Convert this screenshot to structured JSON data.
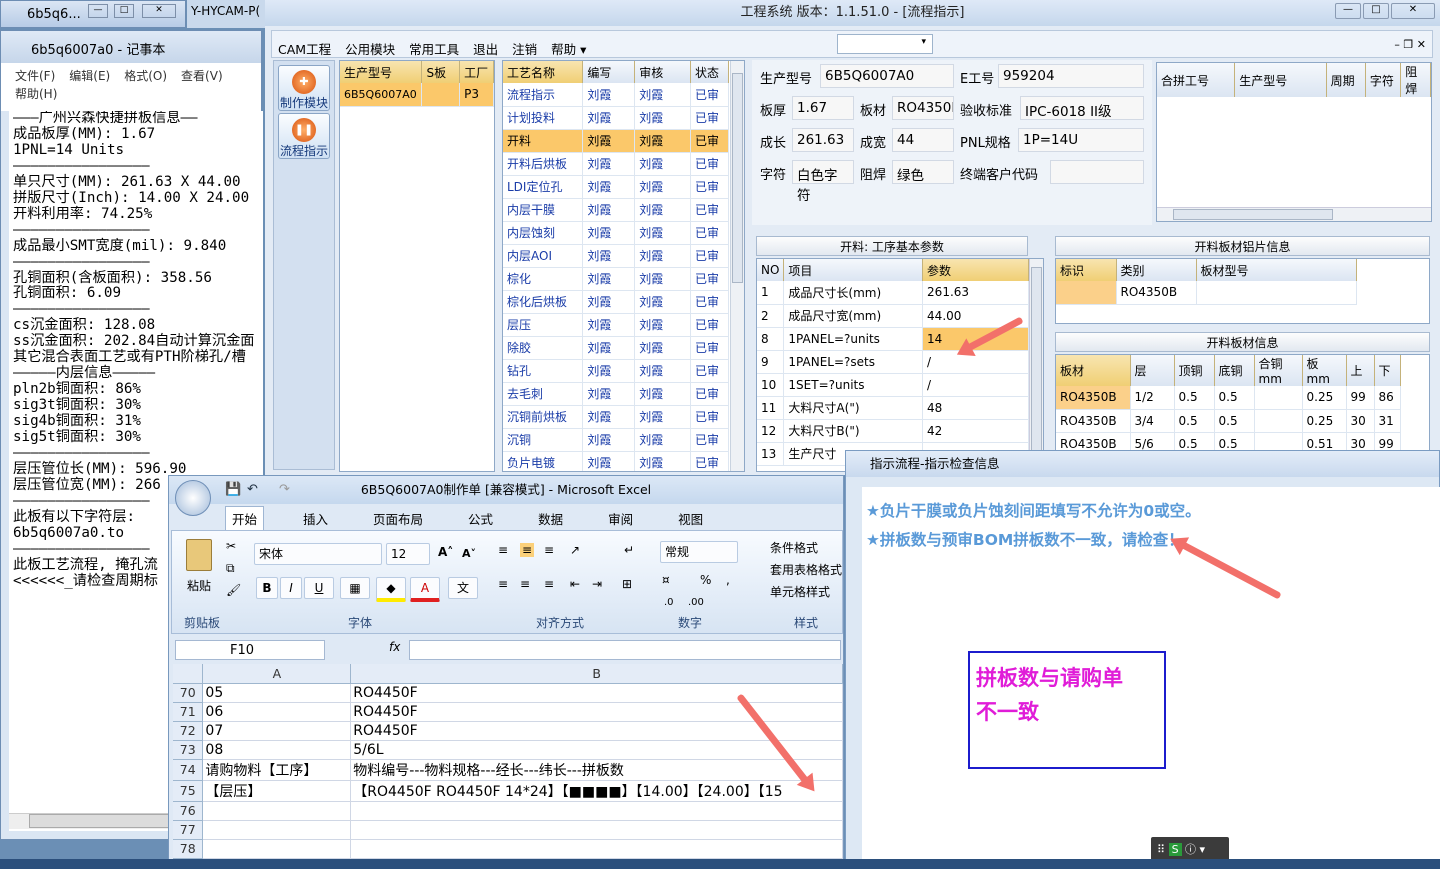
{
  "taskbar_items": {
    "tab1": "6b5q6...",
    "tab2": "Y-HYCAM-P("
  },
  "notepad": {
    "title": "6b5q6007a0 - 记事本",
    "menu": [
      "文件(F)",
      "编辑(E)",
      "格式(O)",
      "查看(V)",
      "帮助(H)"
    ],
    "text": "———广州兴森快捷拼板信息——\n成品板厚(MM): 1.67\n1PNL=14 Units\n————————————————\n单只尺寸(MM): 261.63 X 44.00\n拼版尺寸(Inch): 14.00 X 24.00\n开料利用率: 74.25%\n————————————————\n成品最小SMT宽度(mil): 9.840\n————————————————\n孔铜面积(含板面积): 358.56\n孔铜面积: 6.09\n————————————————\ncs沉金面积: 128.08\nss沉金面积: 202.84自动计算沉金面\n其它混合表面工艺或有PTH阶梯孔/槽\n—————内层信息—————\npln2b铜面积: 86%\nsig3t铜面积: 30%\nsig4b铜面积: 31%\nsig5t铜面积: 30%\n————————————————\n层压管位长(MM): 596.90\n层压管位宽(MM): 266\n————————————————\n此板有以下字符层:\n6b5q6007a0.to\n————————————————\n此板工艺流程, 掩孔流\n<<<<<<_请检查周期标"
  },
  "main": {
    "title": "工程系统  版本：1.1.51.0 - [流程指示]",
    "menu": [
      "CAM工程",
      "公用模块",
      "常用工具",
      "退出",
      "注销",
      "帮助"
    ],
    "nav": [
      "制作模块",
      "流程指示"
    ],
    "products": {
      "headers": [
        "生产型号",
        "S板",
        "工厂"
      ],
      "rows": [
        [
          "6B5Q6007A0",
          "",
          "P3"
        ]
      ]
    },
    "process": {
      "headers": [
        "工艺名称",
        "编写",
        "审核",
        "状态"
      ],
      "rows": [
        [
          "流程指示",
          "刘霞",
          "刘霞",
          "已审"
        ],
        [
          "计划投料",
          "刘霞",
          "刘霞",
          "已审"
        ],
        [
          "开料",
          "刘霞",
          "刘霞",
          "已审"
        ],
        [
          "开料后烘板",
          "刘霞",
          "刘霞",
          "已审"
        ],
        [
          "LDI定位孔",
          "刘霞",
          "刘霞",
          "已审"
        ],
        [
          "内层干膜",
          "刘霞",
          "刘霞",
          "已审"
        ],
        [
          "内层蚀刻",
          "刘霞",
          "刘霞",
          "已审"
        ],
        [
          "内层AOI",
          "刘霞",
          "刘霞",
          "已审"
        ],
        [
          "棕化",
          "刘霞",
          "刘霞",
          "已审"
        ],
        [
          "棕化后烘板",
          "刘霞",
          "刘霞",
          "已审"
        ],
        [
          "层压",
          "刘霞",
          "刘霞",
          "已审"
        ],
        [
          "除胶",
          "刘霞",
          "刘霞",
          "已审"
        ],
        [
          "钻孔",
          "刘霞",
          "刘霞",
          "已审"
        ],
        [
          "去毛刺",
          "刘霞",
          "刘霞",
          "已审"
        ],
        [
          "沉铜前烘板",
          "刘霞",
          "刘霞",
          "已审"
        ],
        [
          "沉铜",
          "刘霞",
          "刘霞",
          "已审"
        ],
        [
          "负片电镀",
          "刘霞",
          "刘霞",
          "已审"
        ]
      ]
    },
    "info": {
      "model_label": "生产型号",
      "model": "6B5Q6007A0",
      "eng_label": "E工号",
      "eng": "959204",
      "thick_label": "板厚",
      "thick": "1.67",
      "mat_label": "板材",
      "mat": "RO4350B",
      "std_label": "验收标准",
      "std": "IPC-6018 II级",
      "len_label": "成长",
      "len": "261.63",
      "wid_label": "成宽",
      "wid": "44",
      "pnl_label": "PNL规格",
      "pnl": "1P=14U",
      "char_label": "字符",
      "char": "白色字符",
      "mask_label": "阻焊",
      "mask": "绿色",
      "cust_label": "终端客户代码",
      "cust": ""
    },
    "merge": {
      "headers": [
        "合拼工号",
        "生产型号",
        "周期",
        "字符",
        "阻焊"
      ]
    },
    "params": {
      "header": "开料: 工序基本参数",
      "cols": [
        "NO",
        "项目",
        "参数"
      ],
      "rows": [
        [
          "1",
          "成品尺寸长(mm)",
          "261.63"
        ],
        [
          "2",
          "成品尺寸宽(mm)",
          "44.00"
        ],
        [
          "8",
          "1PANEL=?units",
          "14"
        ],
        [
          "9",
          "1PANEL=?sets",
          "/"
        ],
        [
          "10",
          "1SET=?units",
          "/"
        ],
        [
          "11",
          "大料尺寸A(\")",
          "48"
        ],
        [
          "12",
          "大料尺寸B(\")",
          "42"
        ],
        [
          "13",
          "生产尺寸",
          ""
        ]
      ]
    },
    "sheetmat": {
      "header": "开料板材铝片信息",
      "cols": [
        "标识",
        "类别",
        "板材型号"
      ],
      "rows": [
        [
          "",
          "RO4350B",
          ""
        ]
      ]
    },
    "matinfo": {
      "header": "开料板材信息",
      "cols": [
        "板材",
        "层",
        "顶铜",
        "底铜",
        "合铜mm",
        "板mm",
        "上",
        "下"
      ],
      "rows": [
        [
          "RO4350B",
          "1/2",
          "0.5",
          "0.5",
          "",
          "0.25",
          "99",
          "86"
        ],
        [
          "RO4350B",
          "3/4",
          "0.5",
          "0.5",
          "",
          "0.25",
          "30",
          "31"
        ],
        [
          "RO4350B",
          "5/6",
          "0.5",
          "0.5",
          "",
          "0.51",
          "30",
          "99"
        ]
      ]
    }
  },
  "excel": {
    "title": "6B5Q6007A0制作单  [兼容模式] - Microsoft Excel",
    "tabs": [
      "开始",
      "插入",
      "页面布局",
      "公式",
      "数据",
      "审阅",
      "视图"
    ],
    "ribbon": {
      "paste": "粘贴",
      "clipboard": "剪贴板",
      "font_group": "字体",
      "font": "宋体",
      "size": "12",
      "align_group": "对齐方式",
      "num_group": "数字",
      "num_fmt": "常规",
      "style_group": "样式",
      "cond": "条件格式",
      "tablefmt": "套用表格格式",
      "cellstyle": "单元格样式",
      "bold": "B",
      "italic": "I",
      "underline": "U",
      "pct": "%"
    },
    "namebox": "F10",
    "fx": "fx",
    "cols": [
      "A",
      "B"
    ],
    "rows": [
      [
        "70",
        "05",
        "RO4450F"
      ],
      [
        "71",
        "06",
        "RO4450F"
      ],
      [
        "72",
        "07",
        "RO4450F"
      ],
      [
        "73",
        "08",
        "5/6L"
      ],
      [
        "74",
        "请购物料【工序】",
        "物料编号---物料规格---经长---纬长---拼板数"
      ],
      [
        "75",
        "【层压】",
        "【RO4450F RO4450F  14*24】【■■■■】【14.00】【24.00】【15"
      ],
      [
        "76",
        "",
        ""
      ],
      [
        "77",
        "",
        ""
      ],
      [
        "78",
        "",
        ""
      ]
    ]
  },
  "dialog": {
    "title": "指示流程-指示检查信息",
    "msg1": "★负片干膜或负片蚀刻间距填写不允许为0或空。",
    "msg2": "★拼板数与预审BOM拼板数不一致，请检查！",
    "note_line1": "拼板数与请购单",
    "note_line2": "不一致"
  },
  "colors": {
    "accent": "#f0cf74",
    "arrow": "#f2706a",
    "note_border": "#1c1ccd",
    "note_text": "#e01cd8",
    "msg": "#5a9ad8"
  }
}
